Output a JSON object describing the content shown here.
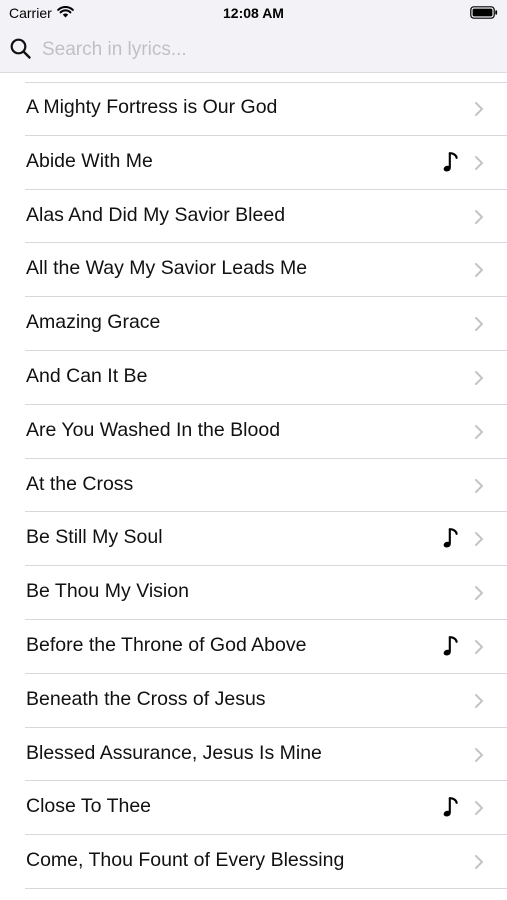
{
  "status_bar": {
    "carrier": "Carrier",
    "time": "12:08 AM"
  },
  "search": {
    "placeholder": "Search in lyrics..."
  },
  "hymns": [
    {
      "title": "A Mighty Fortress is Our God",
      "has_audio": false
    },
    {
      "title": "Abide With Me",
      "has_audio": true
    },
    {
      "title": "Alas And Did My Savior Bleed",
      "has_audio": false
    },
    {
      "title": "All the Way My Savior Leads Me",
      "has_audio": false
    },
    {
      "title": "Amazing Grace",
      "has_audio": false
    },
    {
      "title": "And Can It Be",
      "has_audio": false
    },
    {
      "title": "Are You Washed In the Blood",
      "has_audio": false
    },
    {
      "title": "At the Cross",
      "has_audio": false
    },
    {
      "title": "Be Still My Soul",
      "has_audio": true
    },
    {
      "title": "Be Thou My Vision",
      "has_audio": false
    },
    {
      "title": "Before the Throne of God Above",
      "has_audio": true
    },
    {
      "title": "Beneath the Cross of Jesus",
      "has_audio": false
    },
    {
      "title": "Blessed Assurance, Jesus Is Mine",
      "has_audio": false
    },
    {
      "title": "Close To Thee",
      "has_audio": true
    },
    {
      "title": "Come, Thou Fount of Every Blessing",
      "has_audio": false
    }
  ],
  "colors": {
    "header_bg": "#f2f2f7",
    "separator": "#d8d8dc",
    "chevron": "#c4c4c7",
    "placeholder": "#c0c0c5"
  }
}
